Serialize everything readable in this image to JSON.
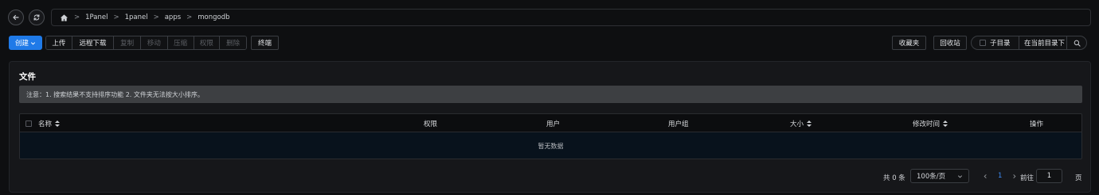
{
  "nav": {
    "back_icon": "arrow-left-icon",
    "refresh_icon": "refresh-icon",
    "breadcrumb": {
      "home_icon": "home-icon",
      "separator": ">",
      "items": [
        "1Panel",
        "1panel",
        "apps",
        "mongodb"
      ]
    }
  },
  "toolbar": {
    "create_label": "创建",
    "create_icon": "chevron-down-icon",
    "file_ops": [
      "上传",
      "远程下载",
      "复制",
      "移动",
      "压缩",
      "权限",
      "删除"
    ],
    "terminal_label": "终端",
    "favorites_label": "收藏夹",
    "recycle_label": "回收站",
    "subdir_label": "子目录",
    "search_placeholder": "在当前目录下",
    "search_icon": "search-icon"
  },
  "panel": {
    "title": "文件",
    "notice": "注意：1. 搜索结果不支持排序功能 2. 文件夹无法按大小排序。",
    "table": {
      "columns": [
        "名称",
        "权限",
        "用户",
        "用户组",
        "大小",
        "修改时间",
        "操作"
      ],
      "sortable": [
        "名称",
        "大小",
        "修改时间"
      ],
      "empty_text": "暂无数据",
      "rows": []
    }
  },
  "pagination": {
    "total_label": "共 0 条",
    "page_size": "100条/页",
    "current_page": "1",
    "goto_label": "前往",
    "goto_value": "1",
    "page_suffix": "页"
  },
  "colors": {
    "primary": "#1f7ae8",
    "background": "#0e0f11",
    "panel": "#16171a",
    "notice": "#3d3f42",
    "active_page": "#3d8bf5"
  }
}
